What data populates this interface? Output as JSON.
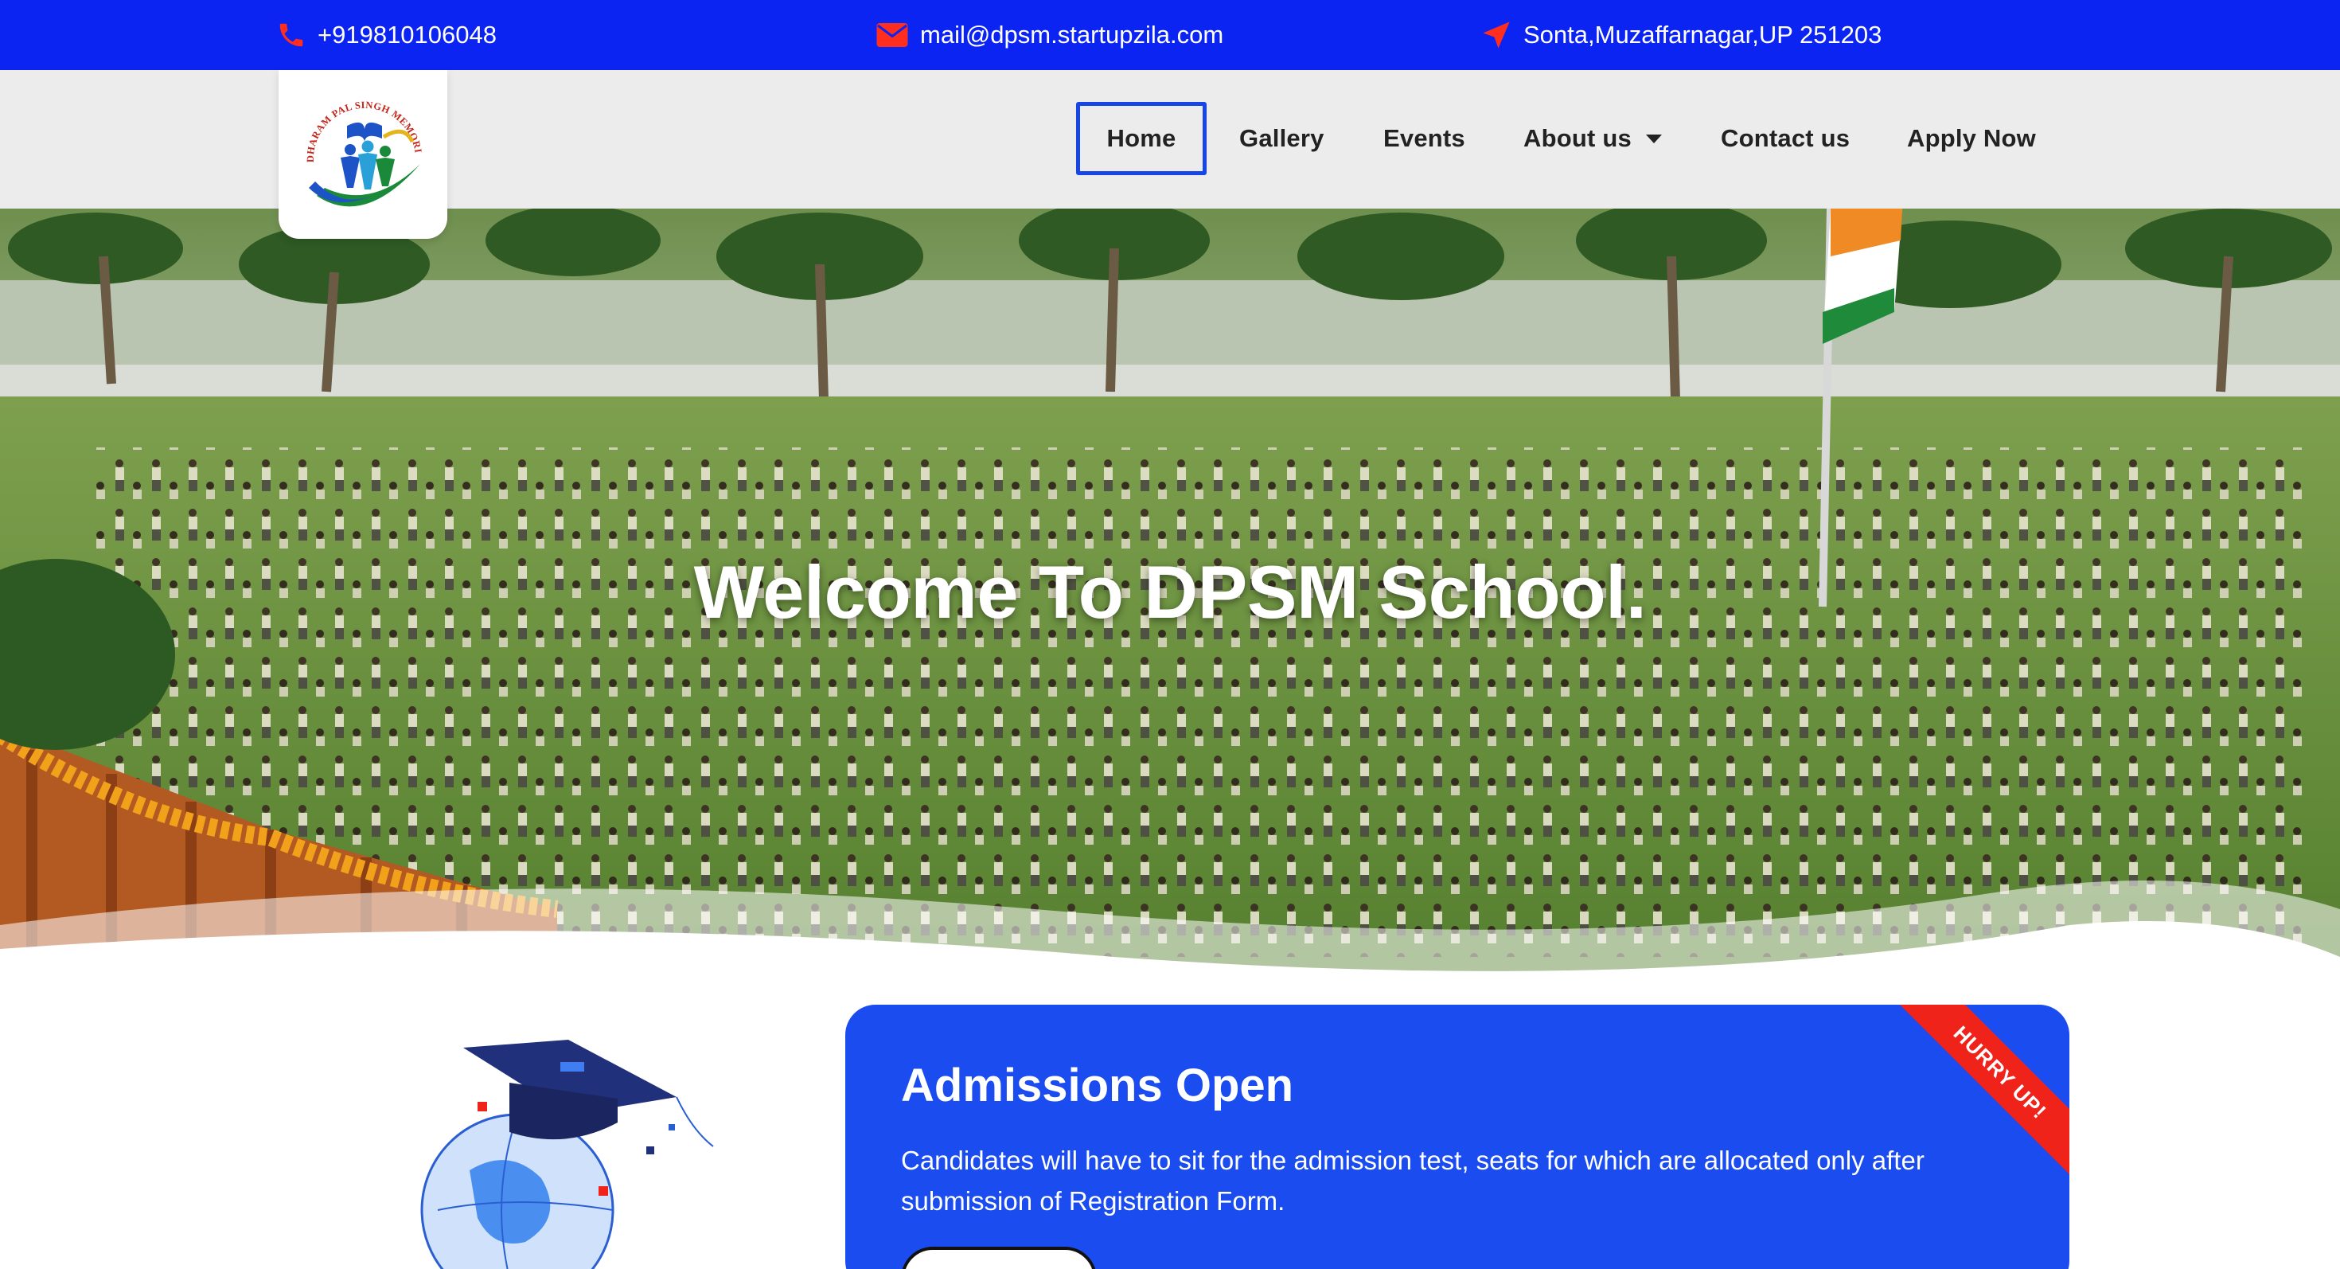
{
  "topbar": {
    "phone": "+919810106048",
    "email": "mail@dpsm.startupzila.com",
    "address": "Sonta,Muzaffarnagar,UP 251203",
    "icons": {
      "phone": "phone-icon",
      "email": "envelope-icon",
      "address": "location-arrow-icon"
    },
    "bg_color": "#0c24f2",
    "icon_color": "#ff2e1f"
  },
  "logo": {
    "alt": "Dharam Pal Singh Memorial School logo",
    "arc_text": "DHARAM PAL SINGH MEMORIAL SCHOOL"
  },
  "nav": {
    "items": [
      {
        "label": "Home",
        "active": true
      },
      {
        "label": "Gallery"
      },
      {
        "label": "Events"
      },
      {
        "label": "About us",
        "has_dropdown": true
      },
      {
        "label": "Contact us"
      },
      {
        "label": "Apply Now"
      }
    ],
    "active_border_color": "#1646e6"
  },
  "hero": {
    "title": "Welcome To DPSM School."
  },
  "admissions": {
    "title": "Admissions Open",
    "text": "Candidates will have to sit for the admission test, seats for which are allocated only after submission of Registration Form.",
    "ribbon": "HURRY UP!",
    "bg_color": "#1a4cf0",
    "ribbon_color": "#f0231b"
  }
}
